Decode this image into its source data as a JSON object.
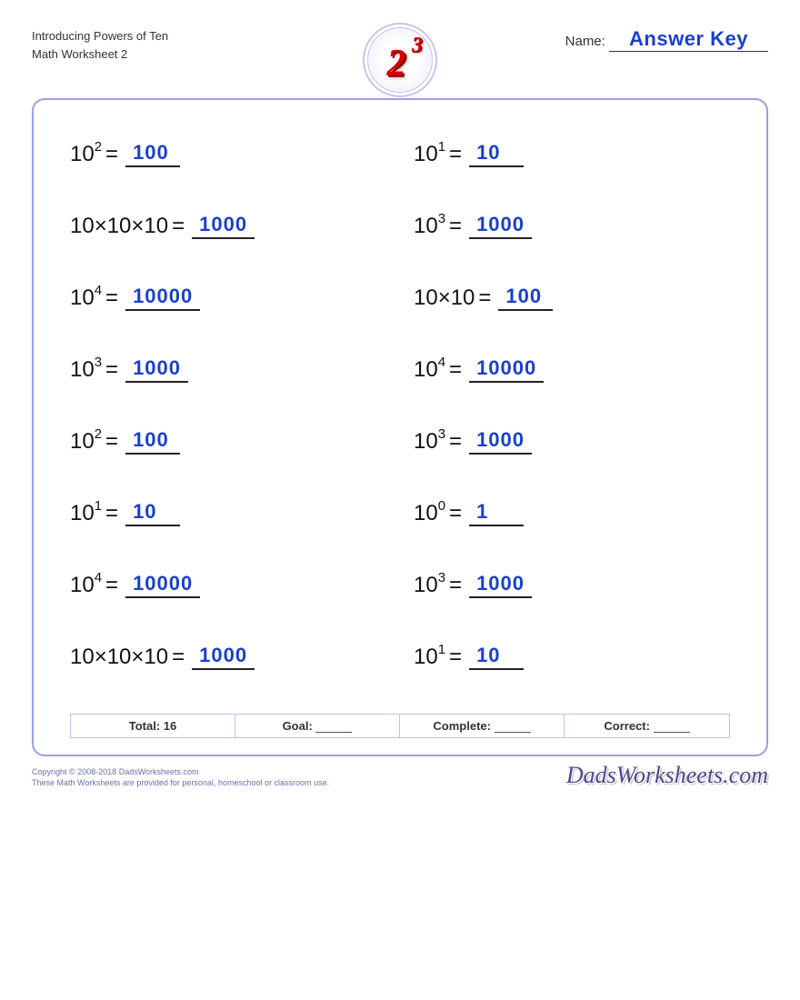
{
  "header": {
    "title_line1": "Introducing Powers of Ten",
    "title_line2": "Math Worksheet 2",
    "badge_base": "2",
    "badge_exp": "3",
    "name_label": "Name:",
    "name_value": "Answer Key"
  },
  "problems": [
    {
      "base": "10",
      "exp": "2",
      "expanded": "",
      "answer": "100"
    },
    {
      "base": "10",
      "exp": "1",
      "expanded": "",
      "answer": "10"
    },
    {
      "base": "",
      "exp": "",
      "expanded": "10×10×10",
      "answer": "1000"
    },
    {
      "base": "10",
      "exp": "3",
      "expanded": "",
      "answer": "1000"
    },
    {
      "base": "10",
      "exp": "4",
      "expanded": "",
      "answer": "10000"
    },
    {
      "base": "",
      "exp": "",
      "expanded": "10×10",
      "answer": "100"
    },
    {
      "base": "10",
      "exp": "3",
      "expanded": "",
      "answer": "1000"
    },
    {
      "base": "10",
      "exp": "4",
      "expanded": "",
      "answer": "10000"
    },
    {
      "base": "10",
      "exp": "2",
      "expanded": "",
      "answer": "100"
    },
    {
      "base": "10",
      "exp": "3",
      "expanded": "",
      "answer": "1000"
    },
    {
      "base": "10",
      "exp": "1",
      "expanded": "",
      "answer": "10"
    },
    {
      "base": "10",
      "exp": "0",
      "expanded": "",
      "answer": "1"
    },
    {
      "base": "10",
      "exp": "4",
      "expanded": "",
      "answer": "10000"
    },
    {
      "base": "10",
      "exp": "3",
      "expanded": "",
      "answer": "1000"
    },
    {
      "base": "",
      "exp": "",
      "expanded": "10×10×10",
      "answer": "1000"
    },
    {
      "base": "10",
      "exp": "1",
      "expanded": "",
      "answer": "10"
    }
  ],
  "score": {
    "total_label": "Total: 16",
    "goal_label": "Goal:",
    "complete_label": "Complete:",
    "correct_label": "Correct:"
  },
  "footer": {
    "copyright": "Copyright © 2008-2018 DadsWorksheets.com",
    "note": "These Math Worksheets are provided for personal, homeschool or classroom use.",
    "brand": "DadsWorksheets.com"
  }
}
